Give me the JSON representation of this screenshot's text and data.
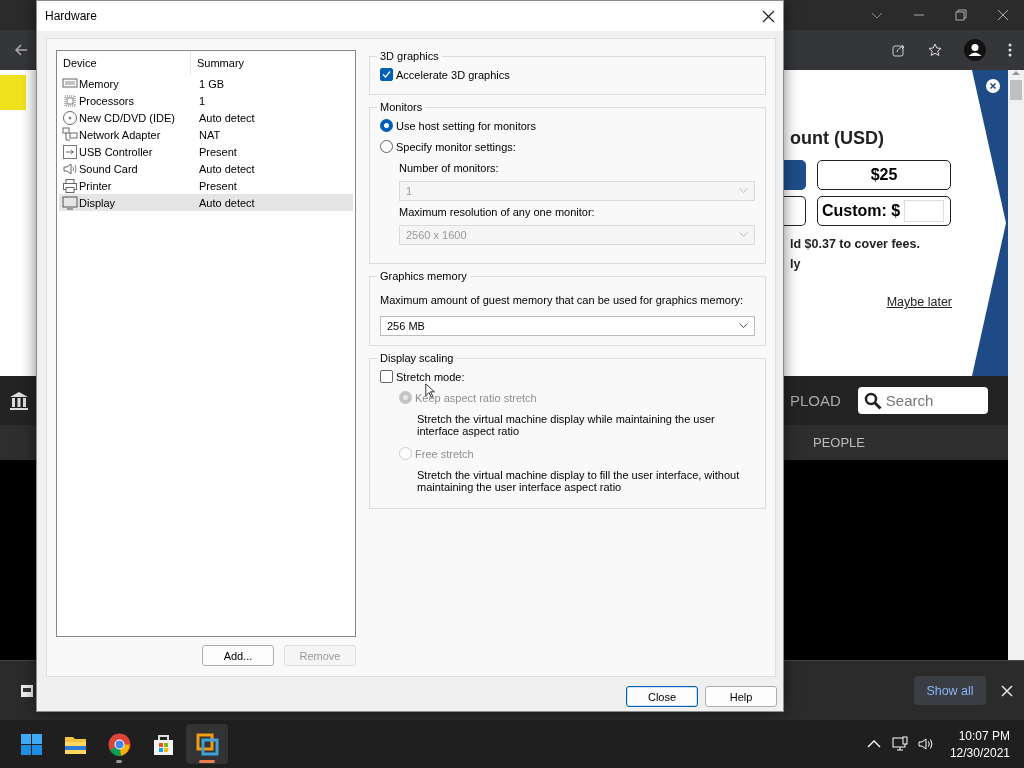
{
  "browser": {
    "popup": {
      "heading": "ount (USD)",
      "cut_amounts": [
        {
          "selected": true
        },
        {
          "selected": false
        }
      ],
      "amount": {
        "label": "$25",
        "selected": false
      },
      "custom_label": "Custom: $",
      "fee_text": "ld $0.37 to cover fees.",
      "option_text": "ly",
      "dismiss_link": "Maybe later"
    },
    "nav": {
      "upload_item": "PLOAD",
      "search_placeholder": "Search",
      "people_item": "PEOPLE"
    },
    "download_bar": {
      "show_all": "Show all"
    }
  },
  "dialog": {
    "title": "Hardware",
    "columns": [
      "Device",
      "Summary"
    ],
    "devices": [
      {
        "kind": "memory",
        "name": "Memory",
        "summary": "1 GB",
        "selected": false
      },
      {
        "kind": "processor",
        "name": "Processors",
        "summary": "1",
        "selected": false
      },
      {
        "kind": "disc",
        "name": "New CD/DVD (IDE)",
        "summary": "Auto detect",
        "selected": false
      },
      {
        "kind": "network",
        "name": "Network Adapter",
        "summary": "NAT",
        "selected": false
      },
      {
        "kind": "usb",
        "name": "USB Controller",
        "summary": "Present",
        "selected": false
      },
      {
        "kind": "sound",
        "name": "Sound Card",
        "summary": "Auto detect",
        "selected": false
      },
      {
        "kind": "printer",
        "name": "Printer",
        "summary": "Present",
        "selected": false
      },
      {
        "kind": "display",
        "name": "Display",
        "summary": "Auto detect",
        "selected": true
      }
    ],
    "list_buttons": [
      {
        "label": "Add...",
        "disabled": false
      },
      {
        "label": "Remove",
        "disabled": true
      }
    ],
    "graphics_3d": {
      "title": "3D graphics",
      "accelerate": {
        "label": "Accelerate 3D graphics",
        "checked": true
      }
    },
    "monitors": {
      "title": "Monitors",
      "options": [
        {
          "label": "Use host setting for monitors",
          "selected": true
        },
        {
          "label": "Specify monitor settings:",
          "selected": false
        }
      ],
      "fields": [
        {
          "label": "Number of monitors:",
          "value": "1",
          "disabled": true
        },
        {
          "label": "Maximum resolution of any one monitor:",
          "value": "2560 x 1600",
          "disabled": true
        }
      ]
    },
    "graphics_memory": {
      "title": "Graphics memory",
      "label": "Maximum amount of guest memory that can be used for graphics memory:",
      "value": "256 MB"
    },
    "display_scaling": {
      "title": "Display scaling",
      "stretch": {
        "label": "Stretch mode:",
        "checked": false
      },
      "options": [
        {
          "label": "Keep aspect ratio stretch",
          "selected": true,
          "disabled": true,
          "description": "Stretch the virtual machine display while maintaining the user interface aspect ratio"
        },
        {
          "label": "Free stretch",
          "selected": false,
          "disabled": true,
          "description": "Stretch the virtual machine display to fill the user interface, without maintaining the user interface aspect ratio"
        }
      ]
    },
    "footer_buttons": [
      {
        "label": "Close",
        "default": true
      },
      {
        "label": "Help",
        "default": false
      }
    ]
  },
  "taskbar": {
    "apps": [
      {
        "kind": "start",
        "running": false,
        "active": false
      },
      {
        "kind": "folder",
        "running": false,
        "active": false
      },
      {
        "kind": "browser",
        "running": true,
        "active": false
      },
      {
        "kind": "store",
        "running": false,
        "active": false
      },
      {
        "kind": "vm",
        "running": true,
        "active": true
      }
    ],
    "time": "10:07 PM",
    "date": "12/30/2021"
  }
}
